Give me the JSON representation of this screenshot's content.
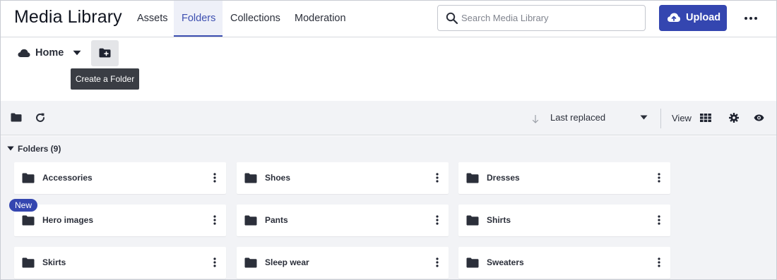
{
  "app": {
    "title": "Media Library"
  },
  "nav": {
    "tabs": [
      "Assets",
      "Folders",
      "Collections",
      "Moderation"
    ],
    "active": "Folders"
  },
  "search": {
    "placeholder": "Search Media Library"
  },
  "actions": {
    "upload_label": "Upload"
  },
  "breadcrumb": {
    "home_label": "Home"
  },
  "tooltip": {
    "text": "Create a Folder"
  },
  "toolbar": {
    "sort_label": "Last replaced",
    "view_label": "View"
  },
  "folders": {
    "header": "Folders (9)",
    "items": [
      {
        "name": "Accessories"
      },
      {
        "name": "Shoes"
      },
      {
        "name": "Dresses"
      },
      {
        "name": "Hero images",
        "badge": "New"
      },
      {
        "name": "Pants"
      },
      {
        "name": "Shirts"
      },
      {
        "name": "Skirts"
      },
      {
        "name": "Sleep wear"
      },
      {
        "name": "Sweaters"
      }
    ]
  },
  "colors": {
    "accent": "#3446b0",
    "active_tab_bg": "#eef0f8",
    "toolbar_bg": "#f2f3f6",
    "icon_dark": "#2b2f3a"
  }
}
